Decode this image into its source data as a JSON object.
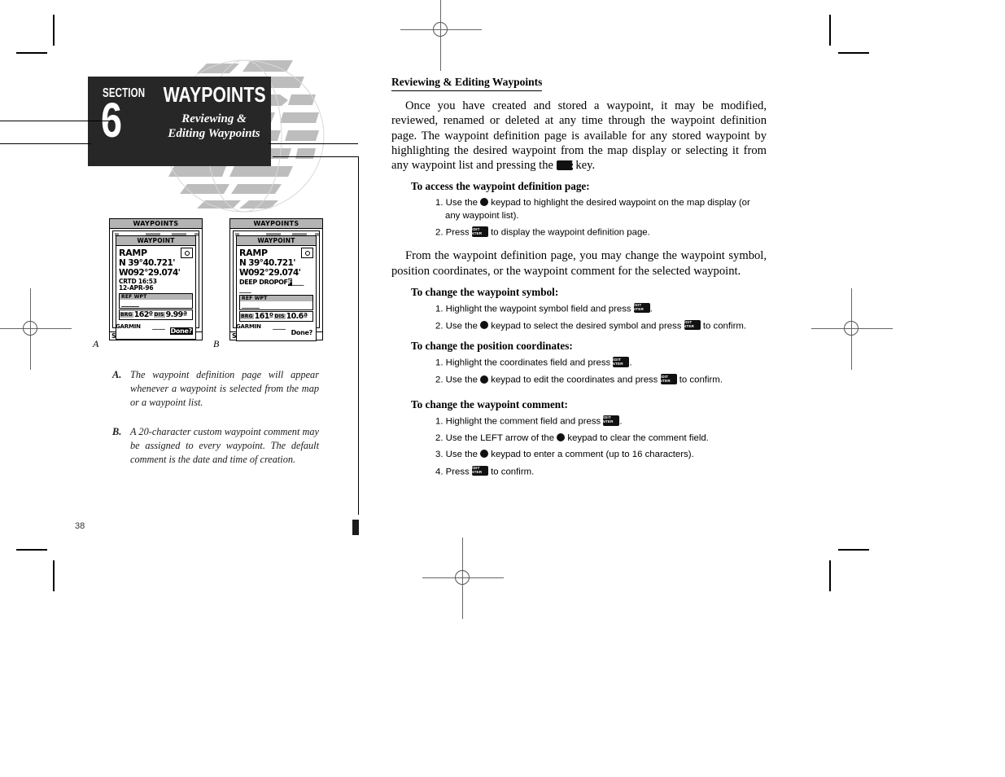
{
  "banner": {
    "section_word": "SECTION",
    "section_number": "6",
    "title": "WAYPOINTS",
    "subtitle_line1": "Reviewing &",
    "subtitle_line2": "Editing Waypoints"
  },
  "figures": {
    "a_letter": "A",
    "b_letter": "B",
    "screen_a": {
      "titlebar": "WAYPOINTS",
      "window_title": "WAYPOINT",
      "waypoint_name": "RAMP",
      "lat": "N  39°40.721'",
      "lon": "W092°29.074'",
      "comment_line1": "CRTD 16:53",
      "comment_line2": "12-APR-96",
      "ref_label": "REF WPT",
      "ref_value": "______",
      "brg_label": "BRG",
      "brg_value": "162º",
      "dis_label": "DIS",
      "dis_value": "9.99ª",
      "done_label": "Done?",
      "brand": "GARMIN",
      "brand_dashes": "______",
      "status": "SIM"
    },
    "screen_b": {
      "titlebar": "WAYPOINTS",
      "window_title": "WAYPOINT",
      "waypoint_name": "RAMP",
      "lat": "N  39°40.721'",
      "lon": "W092°29.074'",
      "comment_line1_pre": "DEEP DROPOF",
      "comment_cursor": "F",
      "comment_line1_post": "____",
      "comment_line2": "____",
      "ref_label": "REF WPT",
      "ref_value": "______",
      "brg_label": "BRG",
      "brg_value": "161º",
      "dis_label": "DIS",
      "dis_value": "10.6ª",
      "done_label": "Done?",
      "brand": "GARMIN",
      "brand_dashes": "______",
      "status": "SIM"
    }
  },
  "captions": [
    {
      "letter": "A.",
      "text": "The waypoint definition page will appear whenever a waypoint is selected from the map or a waypoint list."
    },
    {
      "letter": "B.",
      "text": "A 20-character custom waypoint comment may be assigned to every waypoint. The default comment is the date and time of creation."
    }
  ],
  "main": {
    "heading": "Reviewing & Editing Waypoints",
    "paragraph1_a": "Once you have created and stored a waypoint, it may be modified, reviewed, renamed or deleted at any time through the waypoint definition page. The waypoint definition page is available for any stored waypoint by highlighting the desired waypoint from the map display or selecting it from any waypoint list and pressing the ",
    "paragraph1_b": " key.",
    "paragraph2": "From the waypoint definition page, you may change the waypoint symbol, position coordinates, or the waypoint comment for the selected waypoint.",
    "sections": [
      {
        "subhead": "To access the waypoint definition page:",
        "steps": [
          {
            "pre": "1. Use the ",
            "icon": "rocker-keypad-icon",
            "post": " keypad to highlight the desired waypoint on the map display (or any waypoint list)."
          },
          {
            "pre": "2. Press ",
            "icon": "edit-enter-key-icon",
            "post": " to display the waypoint definition page."
          }
        ]
      },
      {
        "subhead": "To change the waypoint symbol:",
        "steps": [
          {
            "pre": "1. Highlight the waypoint symbol field and press ",
            "icon": "edit-enter-key-icon",
            "post": "."
          },
          {
            "pre": "2. Use the ",
            "icon": "rocker-keypad-icon",
            "mid": " keypad to select the desired symbol and press ",
            "icon2": "edit-enter-key-icon",
            "post": " to confirm."
          }
        ]
      },
      {
        "subhead": "To change the position coordinates:",
        "steps": [
          {
            "pre": "1. Highlight the coordinates field and press ",
            "icon": "edit-enter-key-icon",
            "post": "."
          },
          {
            "pre": "2. Use the ",
            "icon": "rocker-keypad-icon",
            "mid": " keypad to edit the coordinates and press ",
            "icon2": "edit-enter-key-icon",
            "post": " to confirm."
          }
        ]
      },
      {
        "subhead": "To change the waypoint comment:",
        "steps": [
          {
            "pre": "1. Highlight the comment field and press ",
            "icon": "edit-enter-key-icon",
            "post": "."
          },
          {
            "pre": "2. Use the LEFT arrow of the ",
            "icon": "rocker-keypad-icon",
            "post": " keypad to clear the comment field."
          },
          {
            "pre": "3. Use the ",
            "icon": "rocker-keypad-icon",
            "post": " keypad to enter a comment (up to 16 characters)."
          },
          {
            "pre": "4. Press ",
            "icon": "edit-enter-key-icon",
            "post": " to confirm."
          }
        ]
      }
    ]
  },
  "key_glyph": {
    "line1": "EDIT",
    "line2": "ENTER"
  },
  "page_number": "38",
  "colors": {
    "banner_bg": "#272727",
    "lcd_gray": "#b4b4b4",
    "watermark": "#bdbdbd"
  }
}
